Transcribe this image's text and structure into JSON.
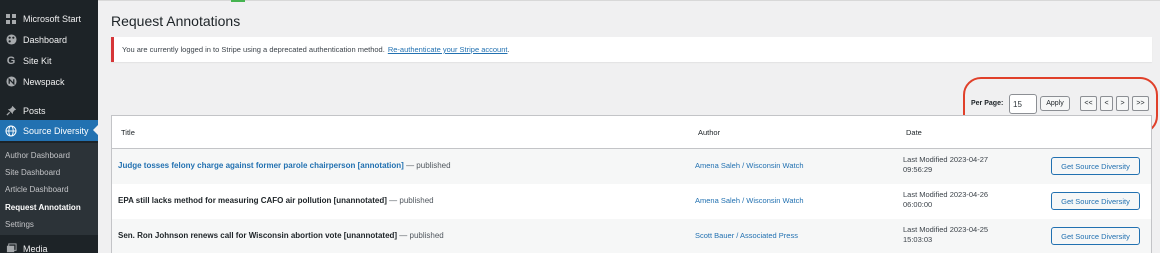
{
  "sidebar": {
    "items": [
      {
        "label": "Microsoft Start",
        "icon": "grid-icon"
      },
      {
        "label": "Dashboard",
        "icon": "palette-icon"
      },
      {
        "label": "Site Kit",
        "icon": "google-g-icon"
      },
      {
        "label": "Newspack",
        "icon": "newspack-icon"
      },
      {
        "label": "Posts",
        "icon": "pin-icon"
      },
      {
        "label": "Source Diversity",
        "icon": "globe-icon"
      }
    ],
    "submenu": [
      {
        "label": "Author Dashboard"
      },
      {
        "label": "Site Dashboard"
      },
      {
        "label": "Article Dashboard"
      },
      {
        "label": "Request Annotation"
      },
      {
        "label": "Settings"
      }
    ],
    "media": {
      "label": "Media",
      "icon": "media-icon"
    }
  },
  "page": {
    "title": "Request Annotations"
  },
  "notice": {
    "text": "You are currently logged in to Stripe using a deprecated authentication method.",
    "link": "Re-authenticate your Stripe account",
    "after": "."
  },
  "pagination": {
    "per_page_label": "Per Page:",
    "per_page_value": "15",
    "apply_label": "Apply",
    "first_label": "<<",
    "prev_label": "<",
    "next_label": ">",
    "last_label": ">>"
  },
  "table": {
    "columns": {
      "title": "Title",
      "author": "Author",
      "date": "Date"
    },
    "rows": [
      {
        "title": "Judge tosses felony charge against former parole chairperson [annotation]",
        "status": " — published",
        "author": "Amena Saleh / Wisconsin Watch",
        "date_line1": "Last Modified 2023-04-27",
        "date_line2": "09:56:29",
        "action": "Get Source Diversity"
      },
      {
        "title": "EPA still lacks method for measuring CAFO air pollution [unannotated]",
        "status": " — published",
        "author": "Amena Saleh / Wisconsin Watch",
        "date_line1": "Last Modified 2023-04-26",
        "date_line2": "06:00:00",
        "action": "Get Source Diversity"
      },
      {
        "title": "Sen. Ron Johnson renews call for Wisconsin abortion vote [unannotated]",
        "status": " — published",
        "author": "Scott Bauer / Associated Press",
        "date_line1": "Last Modified 2023-04-25",
        "date_line2": "15:03:03",
        "action": "Get Source Diversity"
      }
    ]
  },
  "colors": {
    "sidebar_bg": "#1d2327",
    "accent": "#2271b1",
    "notice_error": "#d63638",
    "annotation_circle": "#e0402a"
  }
}
